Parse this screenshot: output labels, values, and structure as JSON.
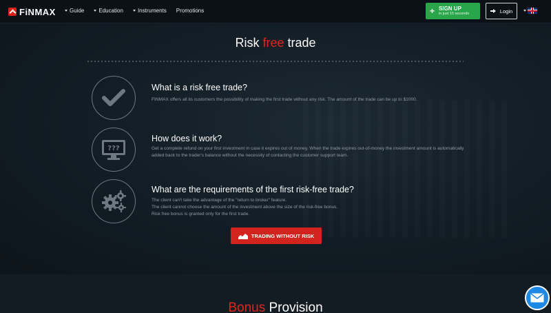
{
  "header": {
    "logo_text": "FiNMAX",
    "nav": [
      {
        "label": "Guide",
        "has_caret": true
      },
      {
        "label": "Education",
        "has_caret": true
      },
      {
        "label": "Instruments",
        "has_caret": true
      },
      {
        "label": "Promotions",
        "has_caret": false
      }
    ],
    "signup": {
      "label": "SIGN UP",
      "sub": "in just 15 seconds"
    },
    "login": {
      "label": "Login"
    },
    "language": "uk-flag-icon"
  },
  "hero": {
    "title_before": "Risk ",
    "title_highlight": "free",
    "title_after": " trade",
    "faqs": [
      {
        "icon": "checkmark-icon",
        "question": "What is a risk free trade?",
        "answer": "FINMAX offers all its customers the possibility of making the first trade without any risk. The amount of the trade can be up to $1000."
      },
      {
        "icon": "monitor-question-icon",
        "question": "How does it work?",
        "answer": "Get a complete refund on your first investment in case it expires out of money. When the trade expires out-of-money the investment amount is automatically added back to the trader's balance without the necessity of contacting the customer support team."
      },
      {
        "icon": "gears-icon",
        "question": "What are the requirements of the first risk-free trade?",
        "answer_lines": [
          "The client can't take the advantage of the \"return to broker\" feature.",
          "The client cannot choose the amount of the investment above the size of the risk-free bonus.",
          "Risk free bonus is granted only for the first trade."
        ]
      }
    ],
    "cta_label": "TRADING WITHOUT RISK"
  },
  "bonus": {
    "title_highlight": "Bonus",
    "title_after": " Provision"
  },
  "colors": {
    "accent_red": "#e0261c",
    "signup_green": "#2aa64a",
    "chat_blue": "#1e88e5"
  }
}
